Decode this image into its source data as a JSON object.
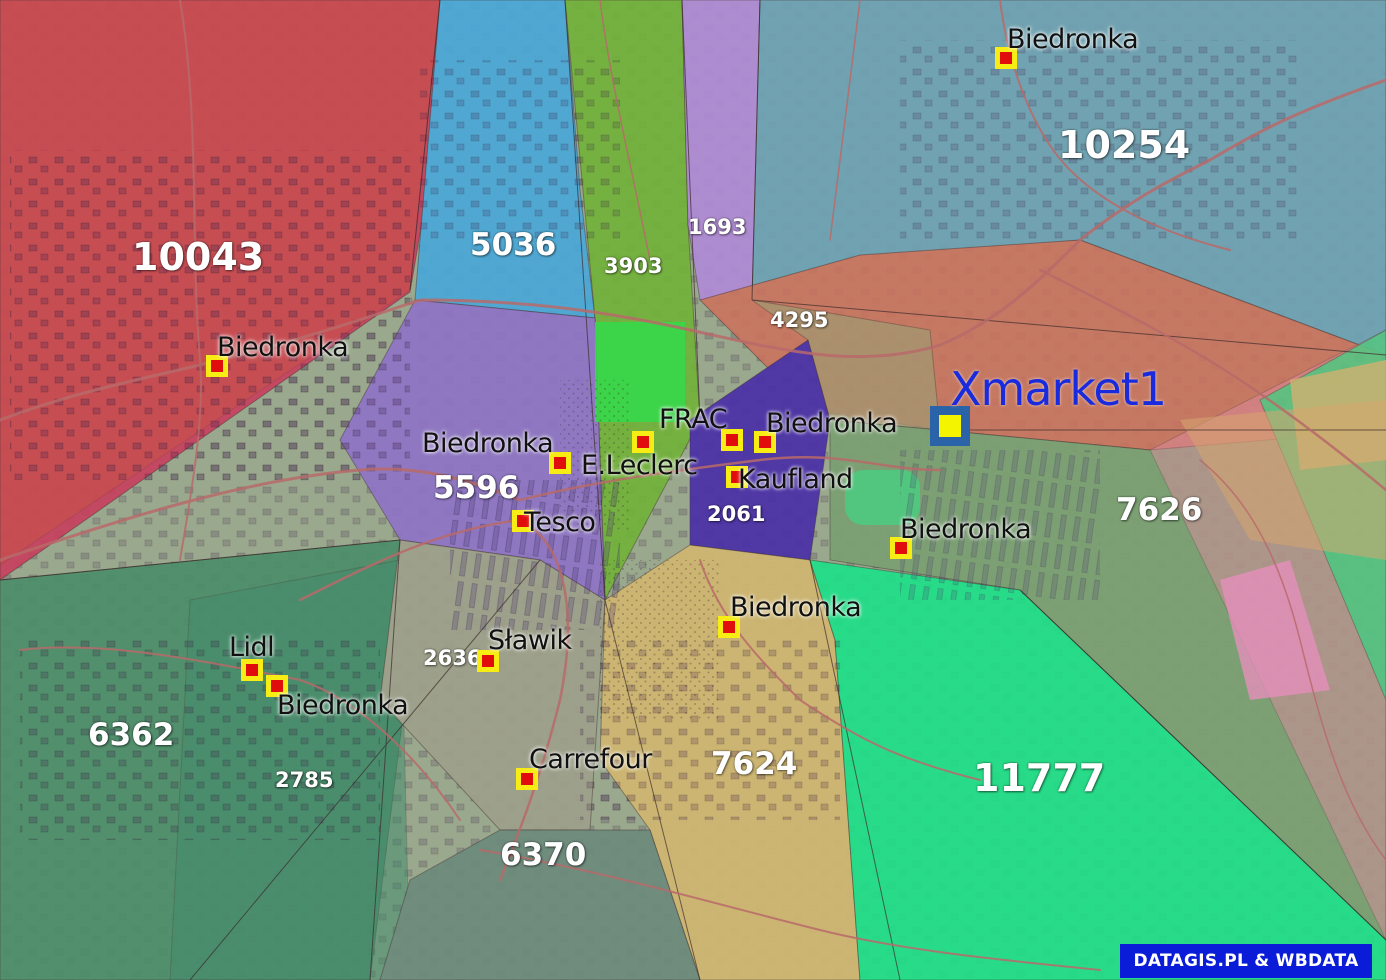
{
  "map": {
    "center_store_label": "Xmarket1",
    "sector_values": [
      "10043",
      "10254",
      "5036",
      "3903",
      "1693",
      "4295",
      "5596",
      "2061",
      "7626",
      "6362",
      "2785",
      "2636",
      "7624",
      "6370",
      "11777"
    ],
    "stores": {
      "biedronka_ne": "Biedronka",
      "biedronka_nw": "Biedronka",
      "biedronka_center_w": "Biedronka",
      "e_leclerc": "E.Leclerc",
      "frac": "FRAC",
      "biedronka_center": "Biedronka",
      "kaufland": "Kaufland",
      "tesco": "Tesco",
      "biedronka_east": "Biedronka",
      "biedronka_south": "Biedronka",
      "slawik": "Sławik",
      "lidl": "Lidl",
      "biedronka_sw": "Biedronka",
      "carrefour": "Carrefour"
    },
    "colors": {
      "marker_fill": "#f7ec13",
      "marker_core": "#e10c0c",
      "center_marker_fill": "#2a63a8",
      "center_marker_core": "#f4f400",
      "center_label": "#1a2bdd",
      "credit_background": "#0a1cd8"
    }
  },
  "footer": {
    "credit": "DATAGIS.PL & WBDATA"
  }
}
